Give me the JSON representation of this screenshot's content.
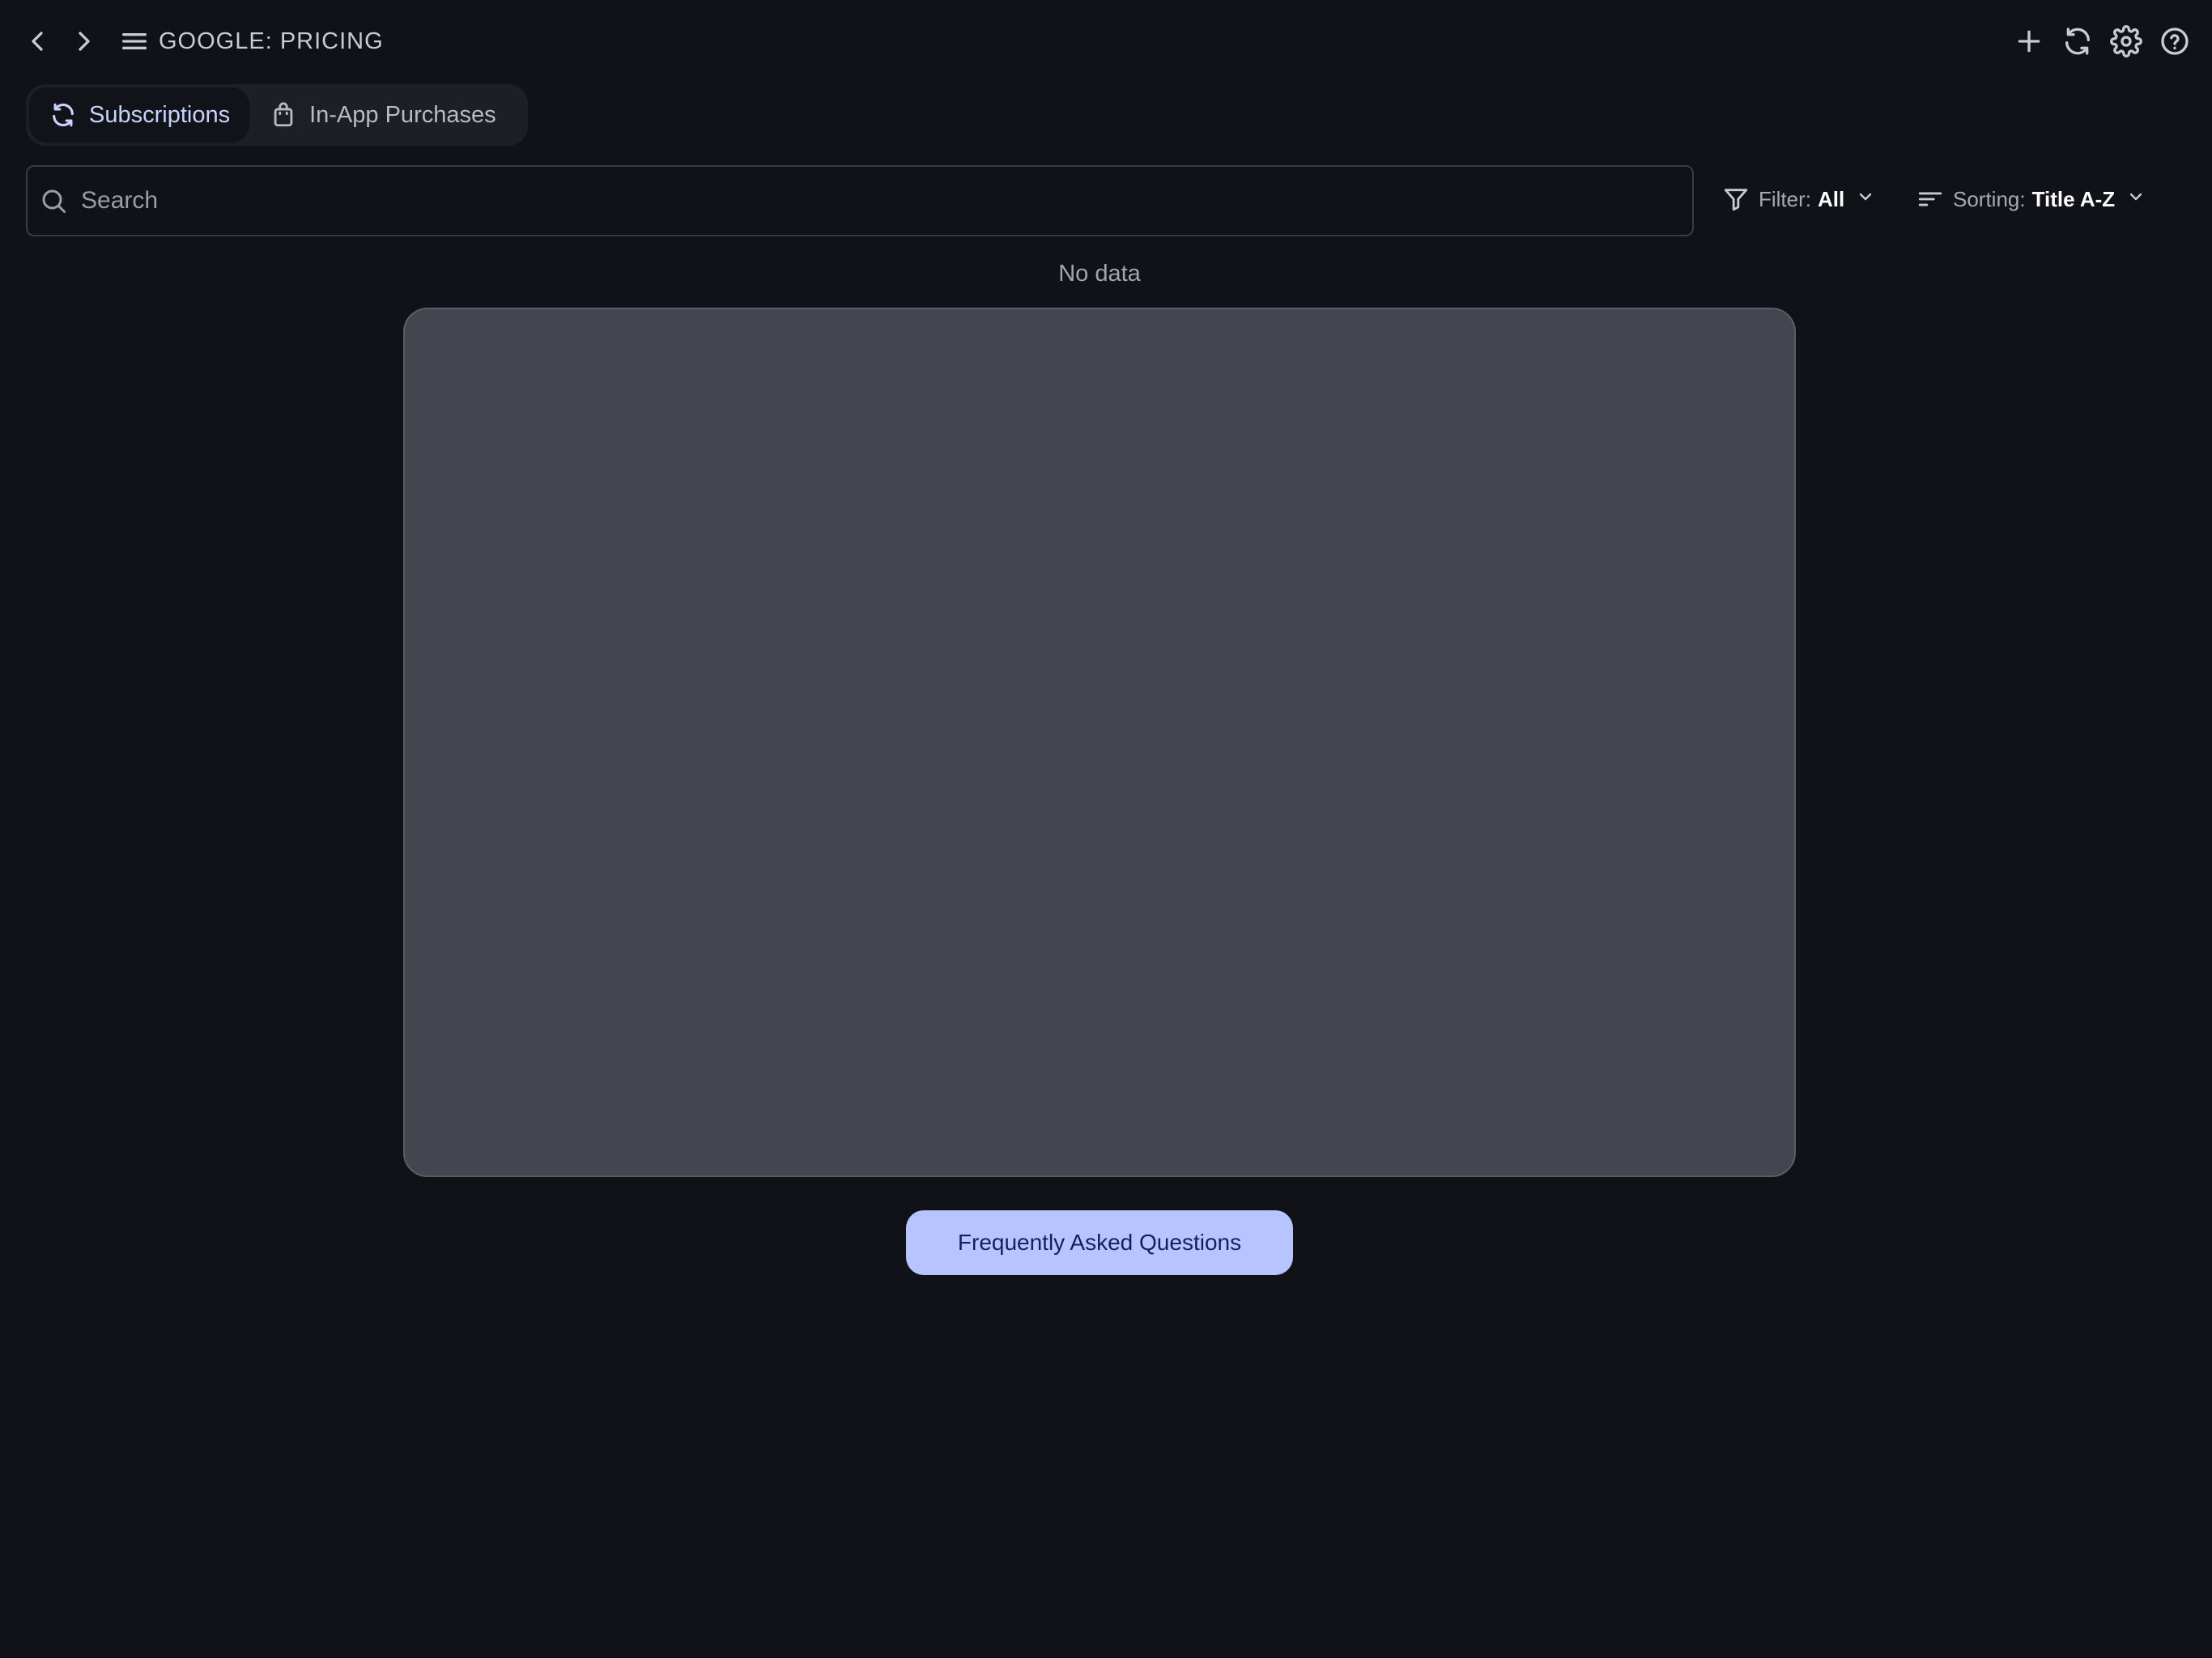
{
  "header": {
    "title": "GOOGLE: PRICING",
    "icons": {
      "back": "chevron-left-icon",
      "forward": "chevron-right-icon",
      "menu": "menu-icon",
      "add": "plus-icon",
      "refresh": "refresh-icon",
      "settings": "gear-icon",
      "help": "help-icon"
    }
  },
  "tabs": [
    {
      "label": "Subscriptions",
      "icon": "refresh-icon",
      "active": true
    },
    {
      "label": "In-App Purchases",
      "icon": "shopping-bag-icon",
      "active": false
    }
  ],
  "search": {
    "placeholder": "Search",
    "value": ""
  },
  "filter": {
    "label": "Filter:",
    "value": "All"
  },
  "sorting": {
    "label": "Sorting:",
    "value": "Title A-Z"
  },
  "content": {
    "empty_text": "No data"
  },
  "faq": {
    "label": "Frequently Asked Questions"
  },
  "colors": {
    "background": "#111218",
    "accent": "#b6c4ff",
    "accent_text": "#142158",
    "active_tab_text": "#c8d2ff",
    "placeholder_box": "#44464f"
  }
}
